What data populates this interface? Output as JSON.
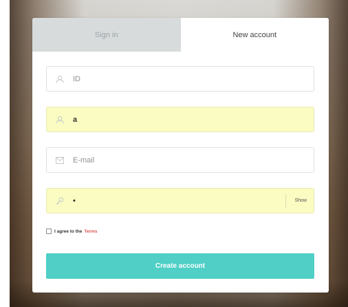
{
  "tabs": {
    "sign_in": "Sign in",
    "new_account": "New account"
  },
  "form": {
    "id_placeholder": "ID",
    "name_value": "a",
    "email_placeholder": "E-mail",
    "password_value": "•",
    "show_label": "Show",
    "agree_text": "I agree to the",
    "terms_link": "Terms",
    "terms_checked": false,
    "submit_label": "Create account"
  },
  "colors": {
    "accent": "#4fcfc6",
    "autofill": "#fafcc2",
    "terms_link": "#e05353",
    "inactive_tab": "#d7dbdb"
  },
  "icons": {
    "id_field": "user-icon",
    "name_field": "user-icon",
    "email_field": "envelope-icon",
    "password_field": "key-icon"
  }
}
